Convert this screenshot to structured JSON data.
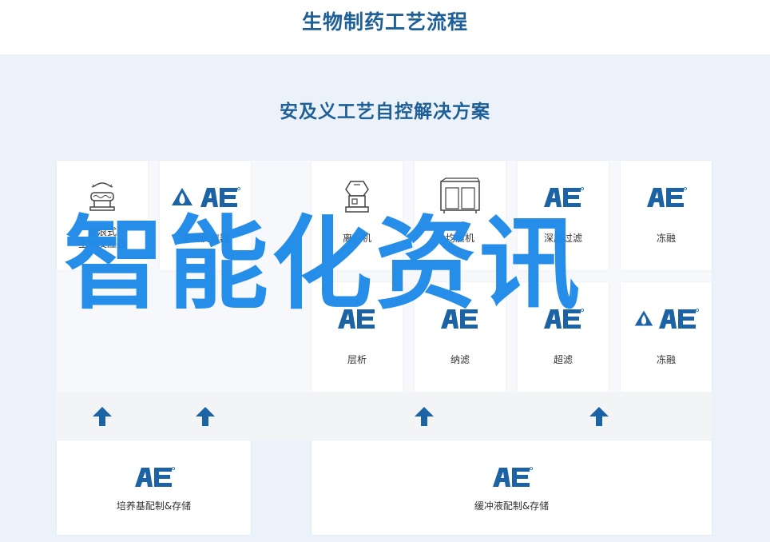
{
  "page_title": "生物制药工艺流程",
  "panel_title": "安及义工艺自控解决方案",
  "logo_text": "AE",
  "watermark": "智能化资讯",
  "top_row": [
    {
      "label": "波浪式\n生物反应器",
      "icon": "wave-bioreactor-icon"
    },
    {
      "label": "生物反应器",
      "icon": "ae-logo-drop"
    },
    {
      "label": "离心机",
      "icon": "centrifuge-icon"
    },
    {
      "label": "均质机",
      "icon": "homogenizer-icon"
    },
    {
      "label": "深层过滤",
      "icon": "ae-logo"
    },
    {
      "label": "冻融",
      "icon": "ae-logo"
    }
  ],
  "mid_row": [
    {
      "label": "层析",
      "icon": "ae-logo"
    },
    {
      "label": "纳滤",
      "icon": "ae-logo"
    },
    {
      "label": "超滤",
      "icon": "ae-logo"
    },
    {
      "label": "冻融",
      "icon": "ae-logo-drop"
    }
  ],
  "bottom_row": [
    {
      "label": "培养基配制&存储",
      "icon": "ae-logo"
    },
    {
      "label": "缓冲液配制&存储",
      "icon": "ae-logo"
    }
  ],
  "colors": {
    "brand": "#1d5f97",
    "logo": "#1b63a5",
    "panel_bg": "#ecf2fa",
    "watermark": "#1f8be8"
  }
}
